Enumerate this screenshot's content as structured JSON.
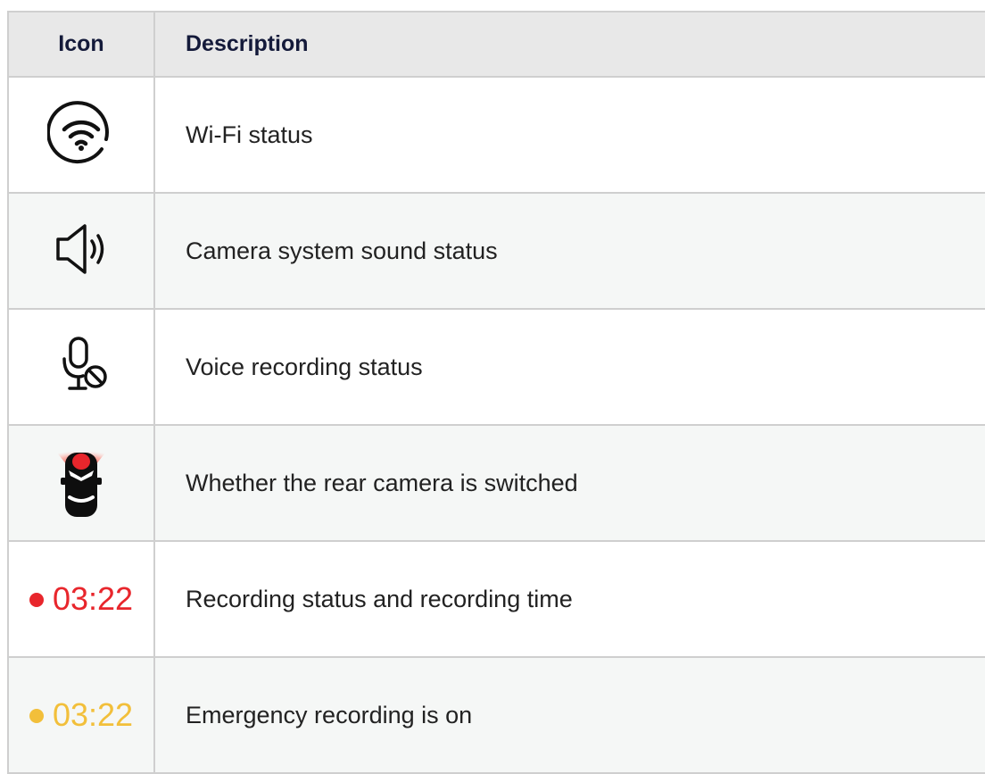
{
  "table": {
    "headers": {
      "icon": "Icon",
      "description": "Description"
    },
    "rows": [
      {
        "icon": "wifi-icon",
        "description": "Wi-Fi status"
      },
      {
        "icon": "speaker-icon",
        "description": "Camera system sound status"
      },
      {
        "icon": "microphone-muted-icon",
        "description": "Voice recording status"
      },
      {
        "icon": "rear-camera-car-icon",
        "description": "Whether the rear camera is switched"
      },
      {
        "icon": "recording-dot-icon",
        "time": "03:22",
        "color": "#e8262c",
        "description": "Recording status and recording time"
      },
      {
        "icon": "emergency-dot-icon",
        "time": "03:22",
        "color": "#f2bf3a",
        "description": "Emergency recording is on"
      }
    ]
  }
}
